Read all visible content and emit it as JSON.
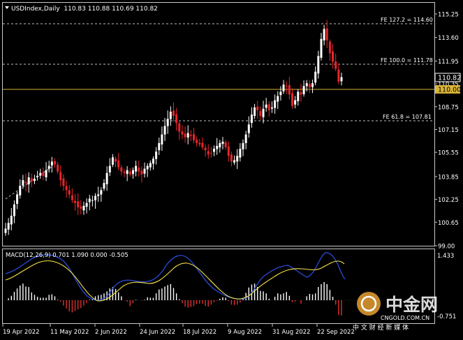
{
  "chart_data": [
    {
      "type": "candlestick",
      "symbol_line": "USDIndex,Daily  110.83 110.88 110.69 110.82",
      "y_ticks": [
        99.0,
        100.65,
        102.25,
        103.85,
        105.55,
        107.15,
        108.75,
        110.35,
        111.95,
        113.6,
        115.25
      ],
      "ylim": [
        99.0,
        115.25
      ],
      "x_labels": [
        "19 Apr 2022",
        "11 May 2022",
        "2 Jun 2022",
        "24 Jun 2022",
        "18 Jul 2022",
        "9 Aug 2022",
        "31 Aug 2022",
        "22 Sep 2022"
      ],
      "current_price_label": "110.82",
      "level_label": "110.00",
      "level_value": 110.0,
      "fib_levels": [
        {
          "label": "FE 127.2 = 114.60",
          "value": 114.6
        },
        {
          "label": "FE 100.0 = 111.78",
          "value": 111.78
        },
        {
          "label": "FE 61.8 = 107.81",
          "value": 107.81
        }
      ],
      "close_series": [
        100.2,
        100.6,
        101.1,
        101.9,
        102.6,
        103.2,
        103.6,
        103.4,
        103.8,
        103.5,
        103.7,
        103.9,
        104.1,
        103.9,
        104.3,
        104.6,
        104.9,
        104.7,
        104.2,
        103.6,
        103.2,
        102.9,
        102.6,
        102.2,
        102.0,
        101.7,
        101.6,
        101.8,
        102.0,
        102.3,
        102.2,
        102.5,
        102.6,
        102.9,
        103.4,
        104.1,
        104.6,
        105.2,
        104.9,
        104.5,
        104.2,
        104.1,
        104.3,
        104.0,
        104.3,
        104.6,
        104.2,
        104.0,
        104.4,
        104.6,
        104.8,
        105.1,
        105.6,
        106.2,
        106.8,
        107.4,
        107.9,
        108.4,
        108.1,
        107.6,
        107.0,
        106.8,
        106.6,
        106.9,
        106.7,
        106.4,
        106.2,
        106.1,
        105.9,
        105.7,
        105.4,
        105.5,
        105.8,
        106.0,
        106.2,
        106.3,
        105.9,
        105.3,
        104.9,
        105.0,
        105.3,
        105.8,
        106.2,
        106.8,
        107.5,
        108.2,
        108.7,
        108.5,
        108.1,
        108.6,
        108.9,
        108.5,
        108.7,
        109.2,
        109.5,
        109.8,
        110.3,
        110.2,
        109.6,
        108.8,
        109.2,
        109.8,
        109.6,
        110.2,
        110.4,
        110.1,
        110.4,
        111.2,
        112.3,
        113.5,
        114.2,
        113.4,
        112.5,
        111.9,
        111.4,
        110.5,
        110.82
      ]
    },
    {
      "type": "macd",
      "header": "MACD(12,26,9) 0.701 1.090 0.000 -0.505",
      "y_label_top": "1.433",
      "y_label_bottom": "-0.751",
      "ylim": [
        -0.751,
        1.433
      ]
    }
  ],
  "watermark": {
    "brand": "中金网",
    "site": "CNGOLD.COM.CN",
    "slogan": "中 文 财 经 新 媒 体"
  },
  "colors": {
    "background": "#000000",
    "bull": "#ffffff",
    "bear": "#e8262b",
    "level_line": "#d9b536",
    "macd_signal": "#f5e44a",
    "macd_main": "#2b4bd8",
    "macd_hist_pos": "#ffffff",
    "macd_hist_neg": "#e0312f"
  }
}
